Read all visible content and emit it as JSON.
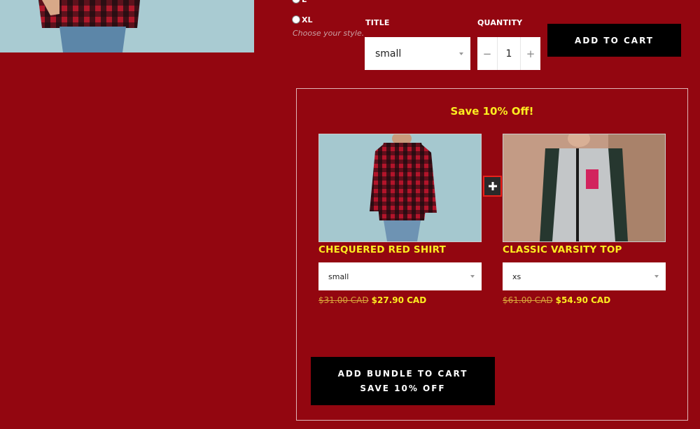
{
  "size_options": [
    {
      "label": "L"
    },
    {
      "label": "XL"
    }
  ],
  "size_help": "Choose your style.",
  "title_field": {
    "label": "TITLE",
    "value": "small"
  },
  "quantity_field": {
    "label": "QUANTITY",
    "value": "1",
    "minus": "−",
    "plus": "+"
  },
  "add_to_cart_label": "ADD TO CART",
  "bundle": {
    "title": "Save 10% Off!",
    "products": [
      {
        "name": "CHEQUERED RED SHIRT",
        "variant": "small",
        "old_price": "$31.00 CAD",
        "new_price": "$27.90 CAD"
      },
      {
        "name": "CLASSIC VARSITY TOP",
        "variant": "xs",
        "old_price": "$61.00 CAD",
        "new_price": "$54.90 CAD"
      }
    ],
    "button_line1": "ADD BUNDLE TO CART",
    "button_line2": "SAVE 10% OFF"
  },
  "colors": {
    "page_bg": "#930610",
    "accent_yellow": "#fcec20",
    "plus_border": "#e8231b"
  },
  "icons": {
    "bundle_plus": "plus-icon"
  }
}
